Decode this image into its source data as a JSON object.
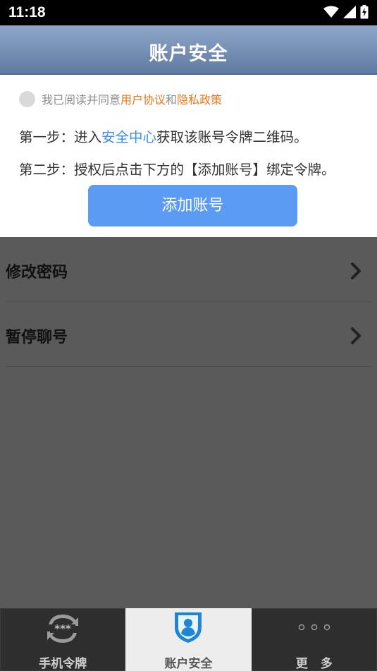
{
  "status_bar": {
    "time": "11:18"
  },
  "header": {
    "title": "账户安全"
  },
  "agreement": {
    "prefix": "我已阅读并同意",
    "user_agreement": "用户协议",
    "conjunction": "和",
    "privacy_policy": "隐私政策",
    "checked": false
  },
  "steps": {
    "step1_prefix": "第一步：进入",
    "step1_link": "安全中心",
    "step1_suffix": "获取该账号令牌二维码。",
    "step2": "第二步：授权后点击下方的【添加账号】绑定令牌。"
  },
  "add_button": {
    "label": "添加账号"
  },
  "menu": {
    "items": [
      {
        "label": "修改密码"
      },
      {
        "label": "暂停聊号"
      }
    ]
  },
  "tabs": [
    {
      "label": "手机令牌",
      "icon": "token-refresh-icon",
      "active": false
    },
    {
      "label": "账户安全",
      "icon": "shield-user-icon",
      "active": true
    },
    {
      "label": "更多",
      "icon": "more-dots-icon",
      "active": false
    }
  ],
  "colors": {
    "header": "#7a93b7",
    "accent_blue": "#5b9bf3",
    "link_orange": "#e8761c",
    "link_blue": "#3a8ee6"
  }
}
